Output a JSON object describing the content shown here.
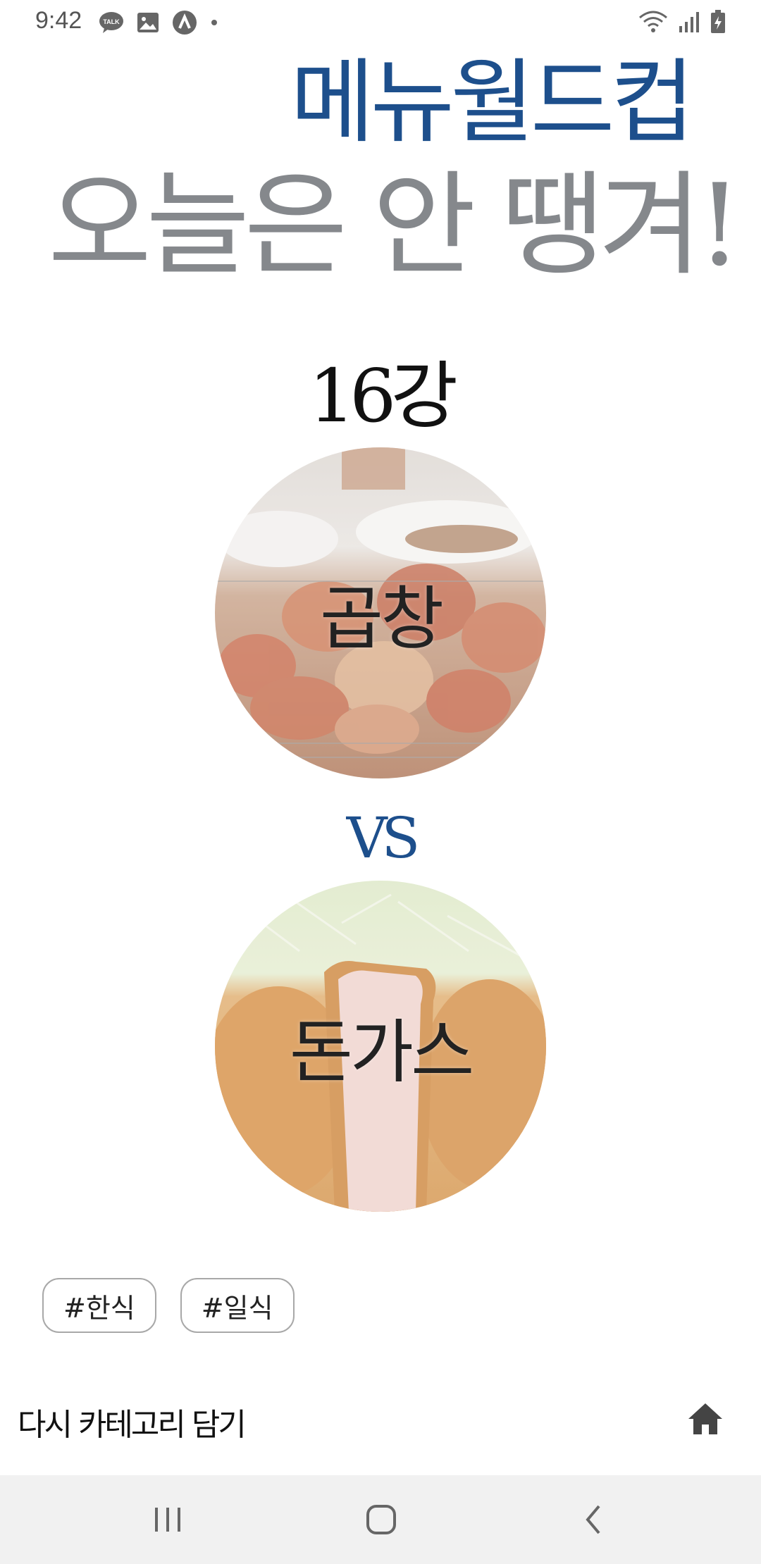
{
  "status_bar": {
    "time": "9:42",
    "notification_icons": [
      "talk-icon",
      "image-icon",
      "nav-arrow-icon",
      "dot-icon"
    ],
    "system_icons": [
      "wifi-icon",
      "signal-icon",
      "battery-charging-icon"
    ]
  },
  "header": {
    "title": "메뉴월드컵",
    "subtitle": "오늘은 안 땡겨!"
  },
  "round": {
    "label": "16강"
  },
  "choices": [
    {
      "label": "곱창",
      "image": "grilled-gopchang-photo"
    },
    {
      "label": "돈가스",
      "image": "tonkatsu-photo"
    }
  ],
  "vs_label": "VS",
  "tags": [
    "#한식",
    "#일식"
  ],
  "footer": {
    "retry_label": "다시 카테고리 담기",
    "home_icon": "home-icon"
  },
  "nav_bar": {
    "icons": [
      "recent-apps-icon",
      "home-circle-icon",
      "back-icon"
    ]
  },
  "colors": {
    "title": "#1d4f8c",
    "subtitle": "#85888c",
    "vs": "#1d4f8c"
  }
}
